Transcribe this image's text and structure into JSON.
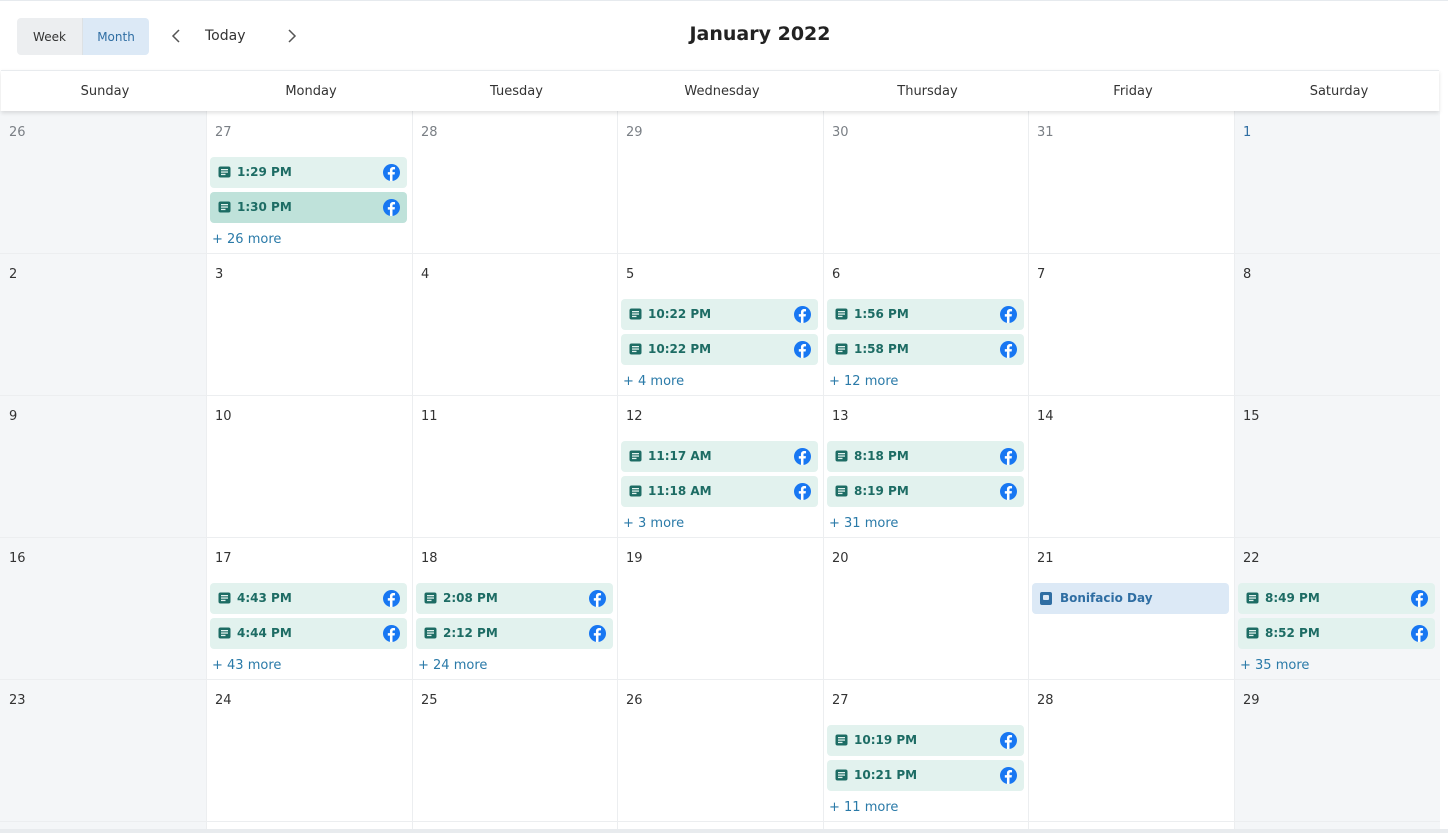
{
  "toolbar": {
    "week_label": "Week",
    "month_label": "Month",
    "today_label": "Today",
    "prev_icon": "chevron-left-icon",
    "next_icon": "chevron-right-icon",
    "title": "January 2022"
  },
  "weekdays": [
    "Sunday",
    "Monday",
    "Tuesday",
    "Wednesday",
    "Thursday",
    "Friday",
    "Saturday"
  ],
  "colors": {
    "event_bg": "#e2f2ee",
    "event_selected_bg": "#bfe2da",
    "event_text": "#1d6c64",
    "holiday_bg": "#dce9f6",
    "holiday_text": "#2f6ea3",
    "facebook_blue": "#1877f2",
    "weekend_bg": "#f4f6f8",
    "link": "#2a7aa8"
  },
  "weeks": [
    [
      {
        "day": "26",
        "outside": true
      },
      {
        "day": "27",
        "outside": true,
        "events": [
          {
            "time": "1:29 PM"
          },
          {
            "time": "1:30 PM",
            "selected": true
          }
        ],
        "more": "+ 26 more"
      },
      {
        "day": "28",
        "outside": true
      },
      {
        "day": "29",
        "outside": true
      },
      {
        "day": "30",
        "outside": true
      },
      {
        "day": "31",
        "outside": true
      },
      {
        "day": "1"
      }
    ],
    [
      {
        "day": "2"
      },
      {
        "day": "3"
      },
      {
        "day": "4"
      },
      {
        "day": "5",
        "events": [
          {
            "time": "10:22 PM"
          },
          {
            "time": "10:22 PM"
          }
        ],
        "more": "+ 4 more"
      },
      {
        "day": "6",
        "events": [
          {
            "time": "1:56 PM"
          },
          {
            "time": "1:58 PM"
          }
        ],
        "more": "+ 12 more"
      },
      {
        "day": "7"
      },
      {
        "day": "8"
      }
    ],
    [
      {
        "day": "9"
      },
      {
        "day": "10"
      },
      {
        "day": "11"
      },
      {
        "day": "12",
        "events": [
          {
            "time": "11:17 AM"
          },
          {
            "time": "11:18 AM"
          }
        ],
        "more": "+ 3 more"
      },
      {
        "day": "13",
        "events": [
          {
            "time": "8:18 PM"
          },
          {
            "time": "8:19 PM"
          }
        ],
        "more": "+ 31 more"
      },
      {
        "day": "14"
      },
      {
        "day": "15"
      }
    ],
    [
      {
        "day": "16"
      },
      {
        "day": "17",
        "events": [
          {
            "time": "4:43 PM"
          },
          {
            "time": "4:44 PM"
          }
        ],
        "more": "+ 43 more"
      },
      {
        "day": "18",
        "events": [
          {
            "time": "2:08 PM"
          },
          {
            "time": "2:12 PM"
          }
        ],
        "more": "+ 24 more"
      },
      {
        "day": "19"
      },
      {
        "day": "20"
      },
      {
        "day": "21",
        "holiday": "Bonifacio Day"
      },
      {
        "day": "22",
        "events": [
          {
            "time": "8:49 PM"
          },
          {
            "time": "8:52 PM"
          }
        ],
        "more": "+ 35 more"
      }
    ],
    [
      {
        "day": "23"
      },
      {
        "day": "24"
      },
      {
        "day": "25"
      },
      {
        "day": "26"
      },
      {
        "day": "27",
        "events": [
          {
            "time": "10:19 PM"
          },
          {
            "time": "10:21 PM"
          }
        ],
        "more": "+ 11 more"
      },
      {
        "day": "28"
      },
      {
        "day": "29"
      }
    ]
  ]
}
